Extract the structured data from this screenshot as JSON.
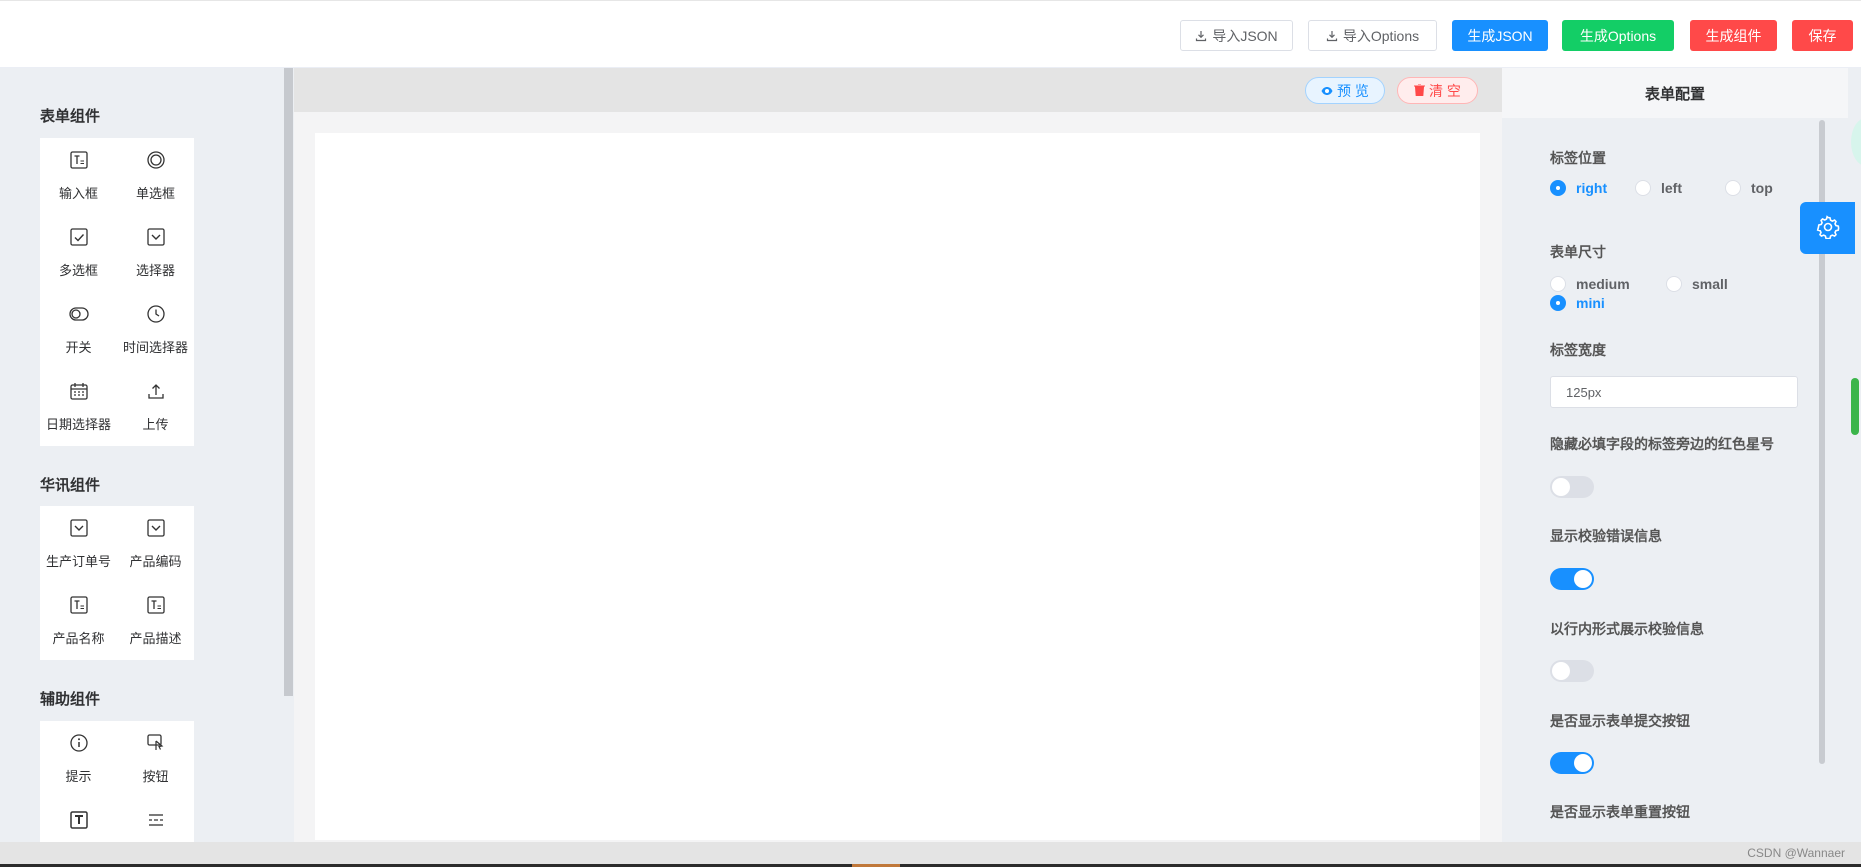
{
  "header": {
    "buttons": [
      {
        "label": "导入JSON",
        "icon": "download-icon"
      },
      {
        "label": "导入Options",
        "icon": "download-icon"
      },
      {
        "label": "生成JSON"
      },
      {
        "label": "生成Options"
      },
      {
        "label": "生成组件"
      },
      {
        "label": "保存"
      }
    ]
  },
  "left": {
    "groups": [
      {
        "title": "表单组件",
        "items": [
          {
            "label": "输入框",
            "icon": "text-input-icon"
          },
          {
            "label": "单选框",
            "icon": "radio-icon"
          },
          {
            "label": "多选框",
            "icon": "checkbox-icon"
          },
          {
            "label": "选择器",
            "icon": "select-icon"
          },
          {
            "label": "开关",
            "icon": "switch-icon"
          },
          {
            "label": "时间选择器",
            "icon": "clock-icon"
          },
          {
            "label": "日期选择器",
            "icon": "calendar-icon"
          },
          {
            "label": "上传",
            "icon": "upload-icon"
          }
        ]
      },
      {
        "title": "华讯组件",
        "items": [
          {
            "label": "生产订单号",
            "icon": "select-icon"
          },
          {
            "label": "产品编码",
            "icon": "select-icon"
          },
          {
            "label": "产品名称",
            "icon": "text-input-icon"
          },
          {
            "label": "产品描述",
            "icon": "text-input-icon"
          }
        ]
      },
      {
        "title": "辅助组件",
        "items": [
          {
            "label": "提示",
            "icon": "info-icon"
          },
          {
            "label": "按钮",
            "icon": "button-icon"
          },
          {
            "label": "",
            "icon": "text-icon"
          },
          {
            "label": "",
            "icon": "divider-icon"
          }
        ]
      }
    ]
  },
  "center": {
    "preview_label": "预 览",
    "clear_label": "清 空"
  },
  "right": {
    "title": "表单配置",
    "label_position": {
      "label": "标签位置",
      "options": [
        "right",
        "left",
        "top"
      ],
      "selected": "right"
    },
    "form_size": {
      "label": "表单尺寸",
      "options": [
        "medium",
        "small",
        "mini"
      ],
      "selected": "mini"
    },
    "label_width": {
      "label": "标签宽度",
      "value": "125px"
    },
    "switches": [
      {
        "label": "隐藏必填字段的标签旁边的红色星号",
        "on": false
      },
      {
        "label": "显示校验错误信息",
        "on": true
      },
      {
        "label": "以行内形式展示校验信息",
        "on": false
      },
      {
        "label": "是否显示表单提交按钮",
        "on": true
      },
      {
        "label": "是否显示表单重置按钮",
        "on": null
      }
    ]
  },
  "footer": {
    "watermark": "CSDN @Wannaer"
  },
  "colors": {
    "primary": "#1890ff",
    "success": "#13ce66",
    "danger": "#ff4949"
  }
}
